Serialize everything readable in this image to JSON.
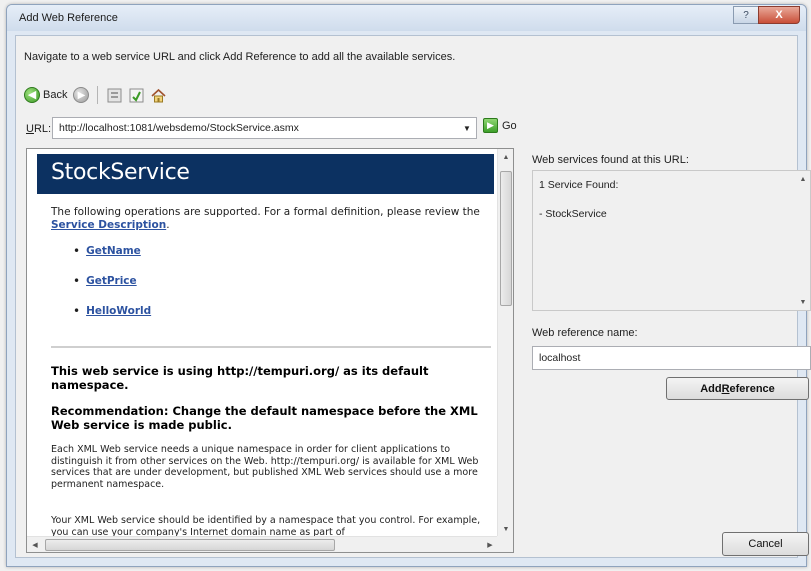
{
  "window": {
    "title": "Add Web Reference",
    "help_label": "?",
    "close_label": "X"
  },
  "instruction": "Navigate to a web service URL and click Add Reference to add all the available services.",
  "toolbar": {
    "back_label": "Back"
  },
  "url": {
    "label_accel": "U",
    "label_rest": "RL:",
    "value": "http://localhost:1081/websdemo/StockService.asmx",
    "go_label": "Go"
  },
  "page": {
    "service_title": "StockService",
    "intro_text": "The following operations are supported. For a formal definition, please review the",
    "intro_link": "Service Description",
    "intro_end": ".",
    "operations": [
      "GetName",
      "GetPrice",
      "HelloWorld"
    ],
    "namespace_title": "This web service is using http://tempuri.org/ as its default namespace.",
    "recommendation_title": "Recommendation: Change the default namespace before the XML Web service is made public.",
    "body_1": "Each XML Web service needs a unique namespace in order for client applications to distinguish it from other services on the Web. http://tempuri.org/ is available for XML Web services that are under development, but published XML Web services should use a more permanent namespace.",
    "body_2": "Your XML Web service should be identified by a namespace that you control. For example, you can use your company's Internet domain name as part of"
  },
  "found": {
    "label": "Web services found at this URL:",
    "count_text": "1 Service Found:",
    "service_item": "- StockService"
  },
  "reference": {
    "label": "Web reference name:",
    "value": "localhost"
  },
  "buttons": {
    "add_reference_pre": "Add ",
    "add_reference_accel": "R",
    "add_reference_post": "eference",
    "cancel": "Cancel"
  }
}
